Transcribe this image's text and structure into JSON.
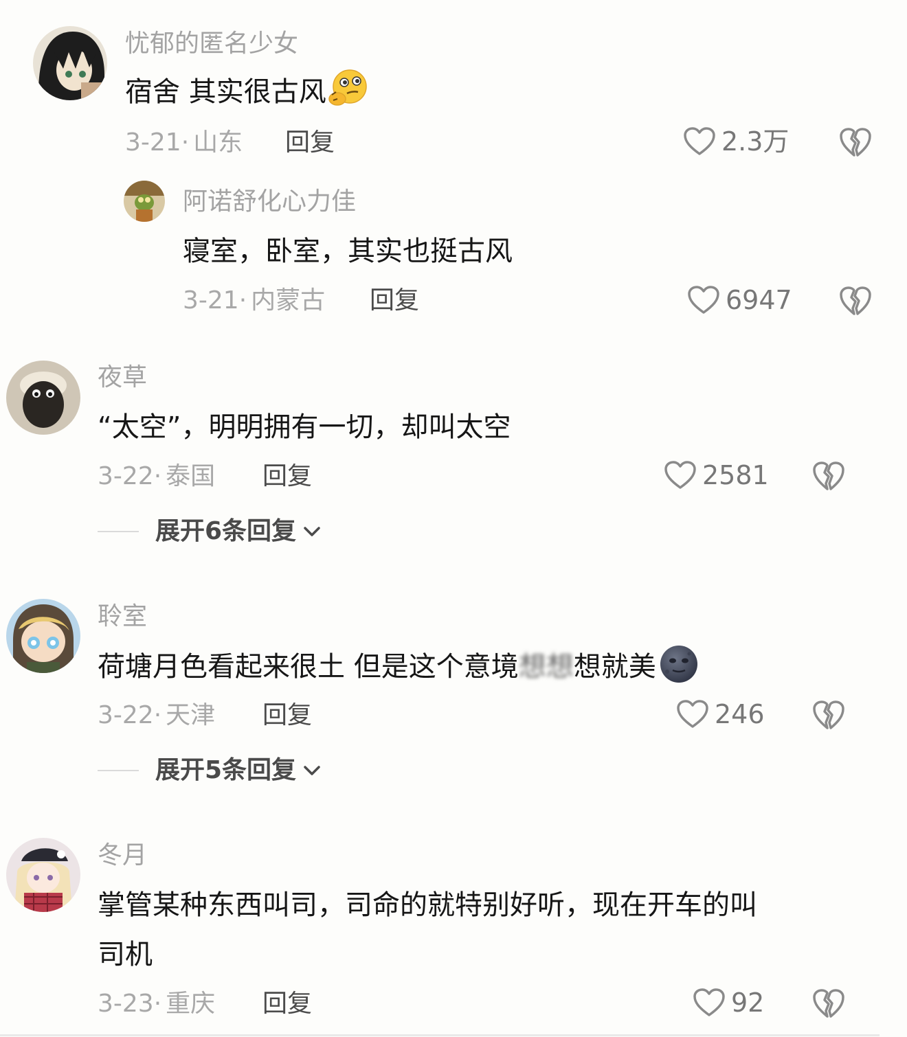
{
  "comments": [
    {
      "username": "忧郁的匿名少女",
      "text": "宿舍 其实很古风",
      "emoji": "thinking-face-icon",
      "date": "3-21",
      "location": "山东",
      "reply_label": "回复",
      "likes": "2.3万",
      "reply": {
        "username": "阿诺舒化心力佳",
        "text": "寝室，卧室，其实也挺古风",
        "date": "3-21",
        "location": "内蒙古",
        "reply_label": "回复",
        "likes": "6947"
      }
    },
    {
      "username": "夜草",
      "text": "“太空”，明明拥有一切，却叫太空",
      "date": "3-22",
      "location": "泰国",
      "reply_label": "回复",
      "likes": "2581",
      "expand_label": "展开6条回复"
    },
    {
      "username": "聆室",
      "text_before": "荷塘月色看起来很土 但是这个意境",
      "text_blurred": "想想",
      "text_after": "想就美",
      "emoji": "new-moon-face-icon",
      "date": "3-22",
      "location": "天津",
      "reply_label": "回复",
      "likes": "246",
      "expand_label": "展开5条回复"
    },
    {
      "username": "冬月",
      "text_line1": "掌管某种东西叫司，司命的就特别好听，现在开车的叫",
      "text_line2": "司机",
      "date": "3-23",
      "location": "重庆",
      "reply_label": "回复",
      "likes": "92"
    }
  ],
  "meta_separator": "·",
  "colors": {
    "background": "#fdfdfb",
    "username": "#a3a3a3",
    "text": "#161616",
    "meta": "#a8a8a8",
    "reply": "#4b4b4b",
    "icon": "#8a8a8a"
  }
}
